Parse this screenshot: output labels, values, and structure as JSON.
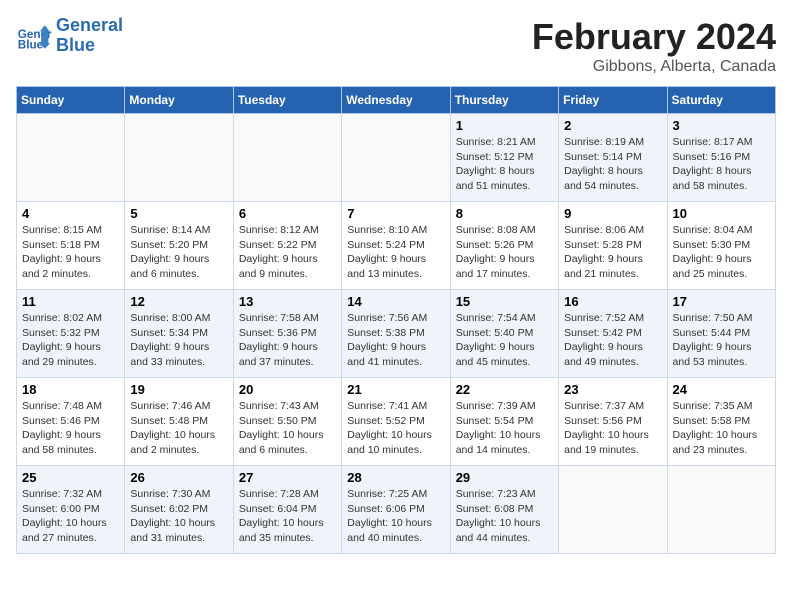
{
  "header": {
    "logo_line1": "General",
    "logo_line2": "Blue",
    "month": "February 2024",
    "location": "Gibbons, Alberta, Canada"
  },
  "weekdays": [
    "Sunday",
    "Monday",
    "Tuesday",
    "Wednesday",
    "Thursday",
    "Friday",
    "Saturday"
  ],
  "weeks": [
    [
      {
        "day": "",
        "info": ""
      },
      {
        "day": "",
        "info": ""
      },
      {
        "day": "",
        "info": ""
      },
      {
        "day": "",
        "info": ""
      },
      {
        "day": "1",
        "info": "Sunrise: 8:21 AM\nSunset: 5:12 PM\nDaylight: 8 hours\nand 51 minutes."
      },
      {
        "day": "2",
        "info": "Sunrise: 8:19 AM\nSunset: 5:14 PM\nDaylight: 8 hours\nand 54 minutes."
      },
      {
        "day": "3",
        "info": "Sunrise: 8:17 AM\nSunset: 5:16 PM\nDaylight: 8 hours\nand 58 minutes."
      }
    ],
    [
      {
        "day": "4",
        "info": "Sunrise: 8:15 AM\nSunset: 5:18 PM\nDaylight: 9 hours\nand 2 minutes."
      },
      {
        "day": "5",
        "info": "Sunrise: 8:14 AM\nSunset: 5:20 PM\nDaylight: 9 hours\nand 6 minutes."
      },
      {
        "day": "6",
        "info": "Sunrise: 8:12 AM\nSunset: 5:22 PM\nDaylight: 9 hours\nand 9 minutes."
      },
      {
        "day": "7",
        "info": "Sunrise: 8:10 AM\nSunset: 5:24 PM\nDaylight: 9 hours\nand 13 minutes."
      },
      {
        "day": "8",
        "info": "Sunrise: 8:08 AM\nSunset: 5:26 PM\nDaylight: 9 hours\nand 17 minutes."
      },
      {
        "day": "9",
        "info": "Sunrise: 8:06 AM\nSunset: 5:28 PM\nDaylight: 9 hours\nand 21 minutes."
      },
      {
        "day": "10",
        "info": "Sunrise: 8:04 AM\nSunset: 5:30 PM\nDaylight: 9 hours\nand 25 minutes."
      }
    ],
    [
      {
        "day": "11",
        "info": "Sunrise: 8:02 AM\nSunset: 5:32 PM\nDaylight: 9 hours\nand 29 minutes."
      },
      {
        "day": "12",
        "info": "Sunrise: 8:00 AM\nSunset: 5:34 PM\nDaylight: 9 hours\nand 33 minutes."
      },
      {
        "day": "13",
        "info": "Sunrise: 7:58 AM\nSunset: 5:36 PM\nDaylight: 9 hours\nand 37 minutes."
      },
      {
        "day": "14",
        "info": "Sunrise: 7:56 AM\nSunset: 5:38 PM\nDaylight: 9 hours\nand 41 minutes."
      },
      {
        "day": "15",
        "info": "Sunrise: 7:54 AM\nSunset: 5:40 PM\nDaylight: 9 hours\nand 45 minutes."
      },
      {
        "day": "16",
        "info": "Sunrise: 7:52 AM\nSunset: 5:42 PM\nDaylight: 9 hours\nand 49 minutes."
      },
      {
        "day": "17",
        "info": "Sunrise: 7:50 AM\nSunset: 5:44 PM\nDaylight: 9 hours\nand 53 minutes."
      }
    ],
    [
      {
        "day": "18",
        "info": "Sunrise: 7:48 AM\nSunset: 5:46 PM\nDaylight: 9 hours\nand 58 minutes."
      },
      {
        "day": "19",
        "info": "Sunrise: 7:46 AM\nSunset: 5:48 PM\nDaylight: 10 hours\nand 2 minutes."
      },
      {
        "day": "20",
        "info": "Sunrise: 7:43 AM\nSunset: 5:50 PM\nDaylight: 10 hours\nand 6 minutes."
      },
      {
        "day": "21",
        "info": "Sunrise: 7:41 AM\nSunset: 5:52 PM\nDaylight: 10 hours\nand 10 minutes."
      },
      {
        "day": "22",
        "info": "Sunrise: 7:39 AM\nSunset: 5:54 PM\nDaylight: 10 hours\nand 14 minutes."
      },
      {
        "day": "23",
        "info": "Sunrise: 7:37 AM\nSunset: 5:56 PM\nDaylight: 10 hours\nand 19 minutes."
      },
      {
        "day": "24",
        "info": "Sunrise: 7:35 AM\nSunset: 5:58 PM\nDaylight: 10 hours\nand 23 minutes."
      }
    ],
    [
      {
        "day": "25",
        "info": "Sunrise: 7:32 AM\nSunset: 6:00 PM\nDaylight: 10 hours\nand 27 minutes."
      },
      {
        "day": "26",
        "info": "Sunrise: 7:30 AM\nSunset: 6:02 PM\nDaylight: 10 hours\nand 31 minutes."
      },
      {
        "day": "27",
        "info": "Sunrise: 7:28 AM\nSunset: 6:04 PM\nDaylight: 10 hours\nand 35 minutes."
      },
      {
        "day": "28",
        "info": "Sunrise: 7:25 AM\nSunset: 6:06 PM\nDaylight: 10 hours\nand 40 minutes."
      },
      {
        "day": "29",
        "info": "Sunrise: 7:23 AM\nSunset: 6:08 PM\nDaylight: 10 hours\nand 44 minutes."
      },
      {
        "day": "",
        "info": ""
      },
      {
        "day": "",
        "info": ""
      }
    ]
  ]
}
